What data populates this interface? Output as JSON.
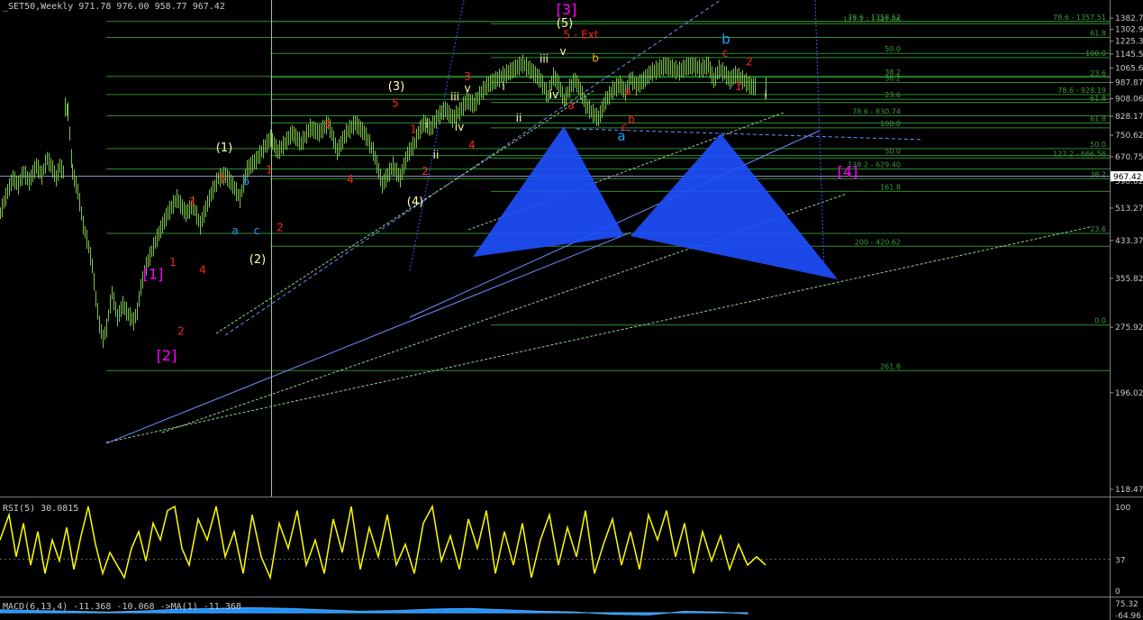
{
  "header": {
    "main_title": "_SET50,Weekly  971.78 976.00 958.77 967.42",
    "rsi_title": "RSI(5) 30.0815",
    "macd_title": "MACD(6,13,4) -11.368 -10.068 ->MA(1) -11.368"
  },
  "colors": {
    "background": "#000000",
    "bars": "#7cc24a",
    "fib_lines": "#2e8b2e",
    "fib_text": "#3f9b3f",
    "trend_blue": "#6f8fff",
    "trend_green": "#8fd08f",
    "harmonic": "#1e50ff",
    "rsi": "#ffff00",
    "macd": "#1e90ff",
    "label_magenta": "#ff00ff",
    "label_red": "#ff2020",
    "label_yellow": "#ffffb0",
    "label_cyan": "#1ea0ff"
  },
  "chart_data": [
    {
      "type": "line",
      "panel": "price",
      "title": "_SET50,Weekly  971.78 976.00 958.77 967.42",
      "ylim": [
        118.47,
        1420
      ],
      "y_ticks": [
        "1382.77",
        "1302.95",
        "1225.33",
        "1145.51",
        "1065.69",
        "987.87",
        "908.06",
        "828.17",
        "750.62",
        "670.75",
        "590.82",
        "513.27",
        "433.37",
        "355.82",
        "275.92",
        "196.02",
        "118.47"
      ],
      "current_price_label": "967.42",
      "x": [
        0,
        8,
        14,
        20,
        26,
        32,
        40,
        46,
        52,
        58,
        62,
        66,
        70,
        72,
        75,
        80,
        86,
        92,
        98,
        102,
        106,
        110,
        114,
        118,
        124,
        130,
        136,
        142,
        148,
        152,
        156,
        162,
        170,
        178,
        186,
        196,
        206,
        214,
        222,
        232,
        242,
        250,
        258,
        266,
        274,
        284,
        292,
        300,
        308,
        316,
        324,
        334,
        344,
        354,
        364,
        374,
        384,
        394,
        404,
        414,
        424,
        436,
        444,
        452,
        460,
        464,
        470,
        478,
        486,
        494,
        502,
        510,
        518,
        526,
        534,
        542,
        550,
        560,
        570,
        580,
        590,
        600,
        608,
        614,
        620,
        626,
        632,
        638,
        644,
        650,
        656,
        664,
        672,
        680,
        688,
        694,
        700,
        706,
        714,
        722,
        730,
        738,
        746,
        754,
        762,
        770,
        778,
        786,
        792,
        798,
        804,
        810,
        816,
        822,
        828,
        834,
        840,
        846,
        850
      ],
      "y": [
        500,
        560,
        600,
        580,
        620,
        590,
        640,
        610,
        665,
        630,
        600,
        640,
        620,
        870,
        850,
        620,
        560,
        470,
        420,
        380,
        320,
        280,
        260,
        275,
        330,
        290,
        310,
        295,
        285,
        300,
        340,
        380,
        420,
        460,
        500,
        540,
        500,
        520,
        470,
        540,
        600,
        610,
        580,
        540,
        630,
        660,
        700,
        740,
        690,
        720,
        760,
        720,
        780,
        760,
        800,
        690,
        760,
        800,
        760,
        690,
        580,
        640,
        600,
        680,
        720,
        760,
        800,
        780,
        830,
        860,
        820,
        850,
        900,
        880,
        940,
        980,
        1000,
        1030,
        1060,
        1090,
        1050,
        1000,
        920,
        1020,
        980,
        900,
        960,
        1000,
        950,
        880,
        850,
        820,
        900,
        950,
        980,
        940,
        1010,
        970,
        1000,
        1040,
        1060,
        1080,
        1065,
        1050,
        1075,
        1080,
        1060,
        1085,
        1000,
        1060,
        1040,
        1000,
        1030,
        1010,
        990,
        970,
        967
      ]
    },
    {
      "type": "line",
      "panel": "rsi",
      "title": "RSI(5) 30.0815",
      "ylim": [
        0,
        100
      ],
      "y_ticks": [
        "100",
        "37",
        "0"
      ],
      "x": [
        0,
        10,
        18,
        26,
        34,
        42,
        50,
        58,
        66,
        74,
        82,
        90,
        98,
        106,
        114,
        122,
        130,
        138,
        146,
        154,
        162,
        170,
        178,
        186,
        194,
        202,
        210,
        220,
        230,
        240,
        250,
        260,
        270,
        280,
        290,
        300,
        310,
        320,
        330,
        340,
        350,
        360,
        370,
        380,
        390,
        400,
        410,
        420,
        430,
        440,
        450,
        460,
        470,
        480,
        490,
        500,
        510,
        520,
        530,
        540,
        550,
        560,
        570,
        580,
        590,
        600,
        610,
        620,
        630,
        640,
        650,
        660,
        670,
        680,
        690,
        700,
        710,
        720,
        730,
        740,
        750,
        760,
        770,
        780,
        790,
        800,
        810,
        820,
        830,
        840,
        850
      ],
      "y": [
        60,
        90,
        40,
        80,
        30,
        70,
        20,
        60,
        35,
        75,
        25,
        65,
        100,
        55,
        20,
        45,
        30,
        15,
        50,
        70,
        35,
        80,
        60,
        95,
        100,
        50,
        30,
        85,
        60,
        100,
        40,
        70,
        20,
        90,
        40,
        15,
        80,
        50,
        95,
        30,
        60,
        20,
        85,
        45,
        100,
        25,
        75,
        40,
        90,
        30,
        55,
        20,
        80,
        100,
        35,
        65,
        25,
        85,
        50,
        95,
        20,
        70,
        30,
        80,
        15,
        60,
        90,
        30,
        75,
        40,
        95,
        20,
        55,
        85,
        30,
        70,
        25,
        90,
        60,
        95,
        40,
        80,
        20,
        70,
        35,
        65,
        25,
        55,
        30,
        40,
        30
      ]
    },
    {
      "type": "area",
      "panel": "macd",
      "title": "MACD(6,13,4) -11.368 -10.068 ->MA(1) -11.368",
      "y_ticks": [
        "75.32",
        "-64.96"
      ],
      "x": [
        0,
        40,
        80,
        120,
        160,
        200,
        240,
        280,
        320,
        360,
        400,
        440,
        480,
        520,
        560,
        600,
        640,
        680,
        720,
        760,
        800,
        830
      ],
      "y": [
        8,
        6,
        4,
        2,
        5,
        10,
        12,
        14,
        12,
        8,
        4,
        6,
        10,
        12,
        8,
        4,
        2,
        -4,
        -6,
        4,
        2,
        -3
      ]
    }
  ],
  "fib_levels_right": [
    {
      "label": "78.6 - 1358.52",
      "value": 1358.52
    },
    {
      "label": "78.6 - 1357.51",
      "value": 1357.51
    },
    {
      "label": "127.2 - 1341.86",
      "value": 1341.86
    },
    {
      "label": "61.8",
      "value": 1250
    },
    {
      "label": "50.0",
      "value": 1150
    },
    {
      "label": "100.0",
      "value": 1125
    },
    {
      "label": "38.2",
      "value": 1020
    },
    {
      "label": "23.6",
      "value": 1015
    },
    {
      "label": "38.2",
      "value": 988
    },
    {
      "label": "78.6 - 928.19",
      "value": 928.19
    },
    {
      "label": "23.6",
      "value": 905
    },
    {
      "label": "61.8",
      "value": 890
    },
    {
      "label": "78.6 - 830.74",
      "value": 830.74
    },
    {
      "label": "61.8",
      "value": 800
    },
    {
      "label": "100.0",
      "value": 780
    },
    {
      "label": "50.0",
      "value": 700
    },
    {
      "label": "50.0",
      "value": 675
    },
    {
      "label": "127.2 - 666.56",
      "value": 666.56
    },
    {
      "label": "138.2 - 629.40",
      "value": 629.4
    },
    {
      "label": "38.2",
      "value": 598
    },
    {
      "label": "161.8",
      "value": 560
    },
    {
      "label": "23.6",
      "value": 450
    },
    {
      "label": "200 - 420.62",
      "value": 420.62
    },
    {
      "label": "0.0",
      "value": 279
    },
    {
      "label": "261.8",
      "value": 220
    }
  ],
  "wave_labels": [
    {
      "text": "[1]",
      "color": "magenta",
      "price": 355,
      "xi": 170
    },
    {
      "text": "[2]",
      "color": "magenta",
      "price": 232,
      "xi": 185
    },
    {
      "text": "[3]",
      "color": "magenta",
      "price": 1410,
      "xi": 629
    },
    {
      "text": "[4]",
      "color": "magenta",
      "price": 605,
      "xi": 941
    },
    {
      "text": "(1)",
      "color": "yellow",
      "price": 690,
      "xi": 249
    },
    {
      "text": "(2)",
      "color": "yellow",
      "price": 385,
      "xi": 286
    },
    {
      "text": "(3)",
      "color": "yellow",
      "price": 950,
      "xi": 440
    },
    {
      "text": "(4)",
      "color": "yellow",
      "price": 520,
      "xi": 461
    },
    {
      "text": "(5)",
      "color": "yellow",
      "price": 1320,
      "xi": 627
    },
    {
      "text": "5 - Ext",
      "color": "red",
      "price": 1245,
      "xi": 645
    },
    {
      "text": "1",
      "color": "red",
      "price": 380,
      "xi": 192
    },
    {
      "text": "2",
      "color": "red",
      "price": 265,
      "xi": 201
    },
    {
      "text": "3",
      "color": "red",
      "price": 520,
      "xi": 213
    },
    {
      "text": "4",
      "color": "red",
      "price": 365,
      "xi": 225
    },
    {
      "text": "5",
      "color": "red",
      "price": 590,
      "xi": 247
    },
    {
      "text": "1",
      "color": "red",
      "price": 615,
      "xi": 299
    },
    {
      "text": "2",
      "color": "red",
      "price": 455,
      "xi": 311
    },
    {
      "text": "3",
      "color": "red",
      "price": 780,
      "xi": 363
    },
    {
      "text": "4",
      "color": "red",
      "price": 585,
      "xi": 389
    },
    {
      "text": "5",
      "color": "red",
      "price": 870,
      "xi": 439
    },
    {
      "text": "1",
      "color": "red",
      "price": 760,
      "xi": 459
    },
    {
      "text": "2",
      "color": "red",
      "price": 610,
      "xi": 472
    },
    {
      "text": "3",
      "color": "red",
      "price": 1000,
      "xi": 519
    },
    {
      "text": "4",
      "color": "red",
      "price": 700,
      "xi": 524
    },
    {
      "text": "a",
      "color": "red",
      "price": 860,
      "xi": 634
    },
    {
      "text": "b",
      "color": "orange",
      "price": 1100,
      "xi": 661
    },
    {
      "text": "a",
      "color": "red",
      "price": 925,
      "xi": 697
    },
    {
      "text": "b",
      "color": "red",
      "price": 800,
      "xi": 701
    },
    {
      "text": "c",
      "color": "red",
      "price": 768,
      "xi": 693
    },
    {
      "text": "c",
      "color": "red",
      "price": 1130,
      "xi": 805
    },
    {
      "text": "1",
      "color": "red",
      "price": 950,
      "xi": 820
    },
    {
      "text": "2",
      "color": "red",
      "price": 1080,
      "xi": 832
    },
    {
      "text": "a",
      "color": "cyan",
      "price": 730,
      "xi": 690
    },
    {
      "text": "b",
      "color": "cyan",
      "price": 1210,
      "xi": 806
    },
    {
      "text": "a",
      "color": "cyan",
      "price": 448,
      "xi": 261
    },
    {
      "text": "b",
      "color": "cyan",
      "price": 578,
      "xi": 273
    },
    {
      "text": "c",
      "color": "cyan",
      "price": 448,
      "xi": 285
    },
    {
      "text": "i",
      "color": "yellow",
      "price": 950,
      "xi": 559
    },
    {
      "text": "ii",
      "color": "yellow",
      "price": 805,
      "xi": 576
    },
    {
      "text": "iii",
      "color": "yellow",
      "price": 1095,
      "xi": 604
    },
    {
      "text": "iv",
      "color": "yellow",
      "price": 910,
      "xi": 615
    },
    {
      "text": "v",
      "color": "yellow",
      "price": 1140,
      "xi": 625
    },
    {
      "text": "i",
      "color": "yellow",
      "price": 780,
      "xi": 474
    },
    {
      "text": "ii",
      "color": "yellow",
      "price": 665,
      "xi": 484
    },
    {
      "text": "iii",
      "color": "yellow",
      "price": 900,
      "xi": 505
    },
    {
      "text": "iv",
      "color": "yellow",
      "price": 768,
      "xi": 510
    },
    {
      "text": "v",
      "color": "yellow",
      "price": 940,
      "xi": 519
    },
    {
      "text": "i",
      "color": "yellow",
      "price": 905,
      "xi": 850
    }
  ]
}
